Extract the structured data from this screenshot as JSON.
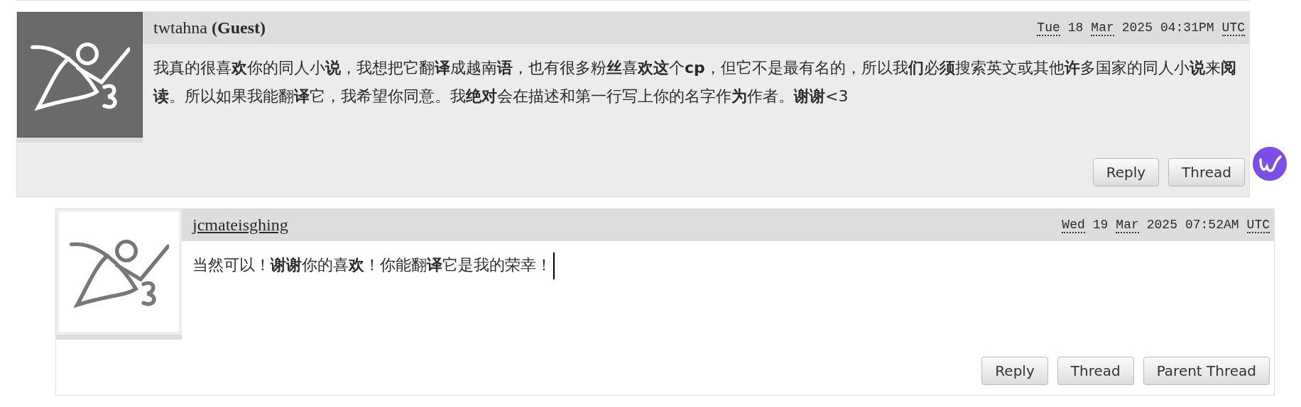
{
  "comments": [
    {
      "author": "twtahna **(Guest)**",
      "author_is_link": false,
      "avatar_dark": true,
      "indented": false,
      "date": {
        "weekday": "Tue",
        "day": "18",
        "month": "Mar",
        "year": "2025",
        "time": "04:31PM",
        "zone": "UTC"
      },
      "body": "我真的很喜**欢**你的同人小**说**，我想把它翻**译**成越南**语**，也有很多粉**丝**喜**欢这**个**cp**，但它不是最有名的，所以我**们**必**须**搜索英文或其他**许**多国家的同人小**说**来**阅读**。所以如果我能翻**译**它，我希望你同意。我**绝对**会在描述和第一行写上你的名字作**为**作者。**谢谢**<3",
      "text_cursor": false,
      "buttons": [
        "Reply",
        "Thread"
      ]
    },
    {
      "author": "jcmateisghing",
      "author_is_link": true,
      "avatar_dark": false,
      "indented": true,
      "date": {
        "weekday": "Wed",
        "day": "19",
        "month": "Mar",
        "year": "2025",
        "time": "07:52AM",
        "zone": "UTC"
      },
      "body": "当然可以！**谢谢**你的喜**欢**！你能翻**译**它是我的荣幸！",
      "text_cursor": true,
      "buttons": [
        "Reply",
        "Thread",
        "Parent Thread"
      ]
    }
  ]
}
